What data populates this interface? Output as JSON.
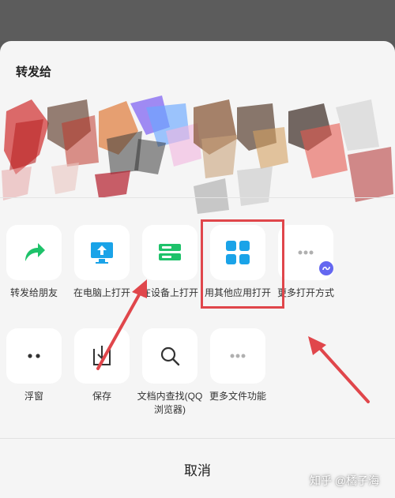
{
  "sheet": {
    "title": "转发给",
    "cancel_label": "取消"
  },
  "actions_row1": [
    {
      "label": "转发给朋友",
      "icon": "share-forward-icon",
      "color": "#1ec26a"
    },
    {
      "label": "在电脑上打开",
      "icon": "computer-upload-icon",
      "color": "#1aa3e8"
    },
    {
      "label": "在设备上打开",
      "icon": "device-server-icon",
      "color": "#1ec26a"
    },
    {
      "label": "用其他应用打开",
      "icon": "app-grid-icon",
      "color": "#1aa3e8"
    },
    {
      "label": "更多打开方式",
      "icon": "more-dots-icon",
      "color": "#b0b0b0"
    }
  ],
  "actions_row2": [
    {
      "label": "浮窗",
      "icon": "floating-window-icon",
      "color": "#333333"
    },
    {
      "label": "保存",
      "icon": "save-download-icon",
      "color": "#333333"
    },
    {
      "label": "文档内查找(QQ浏览器)",
      "icon": "search-icon",
      "color": "#333333"
    },
    {
      "label": "更多文件功能",
      "icon": "more-dots-icon",
      "color": "#b0b0b0"
    }
  ],
  "annotation": {
    "highlight_color": "#e0464b"
  },
  "watermark": "知乎 @橘子海"
}
